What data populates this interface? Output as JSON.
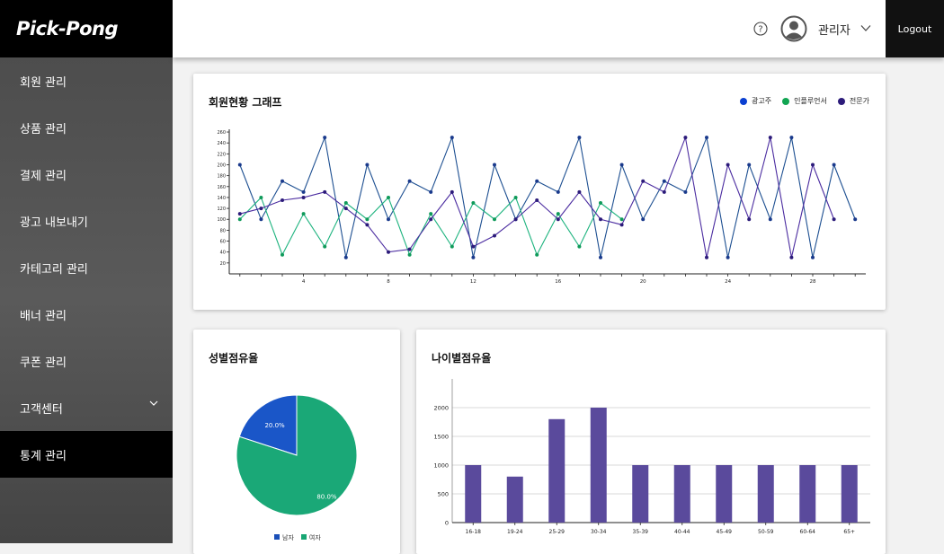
{
  "brand": "Pick-Pong",
  "sidebar": {
    "items": [
      {
        "label": "회원 관리"
      },
      {
        "label": "상품 관리"
      },
      {
        "label": "결제 관리"
      },
      {
        "label": "광고 내보내기"
      },
      {
        "label": "카테고리 관리"
      },
      {
        "label": "배너 관리"
      },
      {
        "label": "쿠폰 관리"
      },
      {
        "label": "고객센터"
      },
      {
        "label": "통계 관리"
      }
    ]
  },
  "topbar": {
    "admin_name": "관리자",
    "logout_label": "Logout"
  },
  "colors": {
    "advertiser": "#1d4f91",
    "influencer": "#1db37e",
    "expert": "#4b2ca0",
    "male": "#1a56c8",
    "female": "#1aa877",
    "bar": "#5a4a9c"
  },
  "line_card": {
    "title": "회원현황 그래프"
  },
  "gender_card": {
    "title": "성별점유율"
  },
  "age_card": {
    "title": "나이별점유율"
  },
  "chart_data": [
    {
      "type": "line",
      "title": "회원현황 그래프",
      "x": [
        1,
        2,
        3,
        4,
        5,
        6,
        7,
        8,
        9,
        10,
        11,
        12,
        13,
        14,
        15,
        16,
        17,
        18,
        19,
        20,
        21,
        22,
        23,
        24,
        25,
        26,
        27,
        28,
        29,
        30
      ],
      "xticks": [
        4,
        8,
        12,
        16,
        20,
        24,
        28
      ],
      "yticks": [
        20,
        40,
        60,
        80,
        100,
        120,
        140,
        160,
        180,
        200,
        220,
        240,
        260
      ],
      "ylim": [
        0,
        265
      ],
      "legend_position": "top-right",
      "series": [
        {
          "name": "광고주",
          "values": [
            200,
            100,
            170,
            150,
            250,
            30,
            200,
            100,
            170,
            150,
            250,
            30,
            200,
            100,
            170,
            150,
            250,
            30,
            200,
            100,
            170,
            150,
            250,
            30,
            200,
            100,
            250,
            30,
            200,
            100
          ]
        },
        {
          "name": "인플루언서",
          "values": [
            100,
            140,
            35,
            110,
            50,
            130,
            100,
            140,
            35,
            110,
            50,
            130,
            100,
            140,
            35,
            110,
            50,
            130,
            100,
            null,
            null,
            null,
            null,
            null,
            null,
            null,
            null,
            null,
            null,
            null
          ]
        },
        {
          "name": "전문가",
          "values": [
            110,
            120,
            135,
            140,
            150,
            120,
            90,
            40,
            45,
            100,
            150,
            50,
            70,
            100,
            135,
            100,
            150,
            100,
            90,
            170,
            150,
            250,
            30,
            200,
            100,
            250,
            30,
            200,
            100,
            null
          ]
        }
      ]
    },
    {
      "type": "pie",
      "title": "성별점유율",
      "categories": [
        "남자",
        "여자"
      ],
      "values": [
        20.0,
        80.0
      ],
      "labels": [
        "20.0%",
        "80.0%"
      ]
    },
    {
      "type": "bar",
      "title": "나이별점유율",
      "categories": [
        "16-18",
        "19-24",
        "25-29",
        "30-34",
        "35-39",
        "40-44",
        "45-49",
        "50-59",
        "60-64",
        "65+"
      ],
      "values": [
        1000,
        800,
        1800,
        2000,
        1000,
        1000,
        1000,
        1000,
        1000,
        1000
      ],
      "yticks": [
        0,
        500,
        1000,
        1500,
        2000
      ],
      "ylim": [
        0,
        2500
      ]
    }
  ]
}
